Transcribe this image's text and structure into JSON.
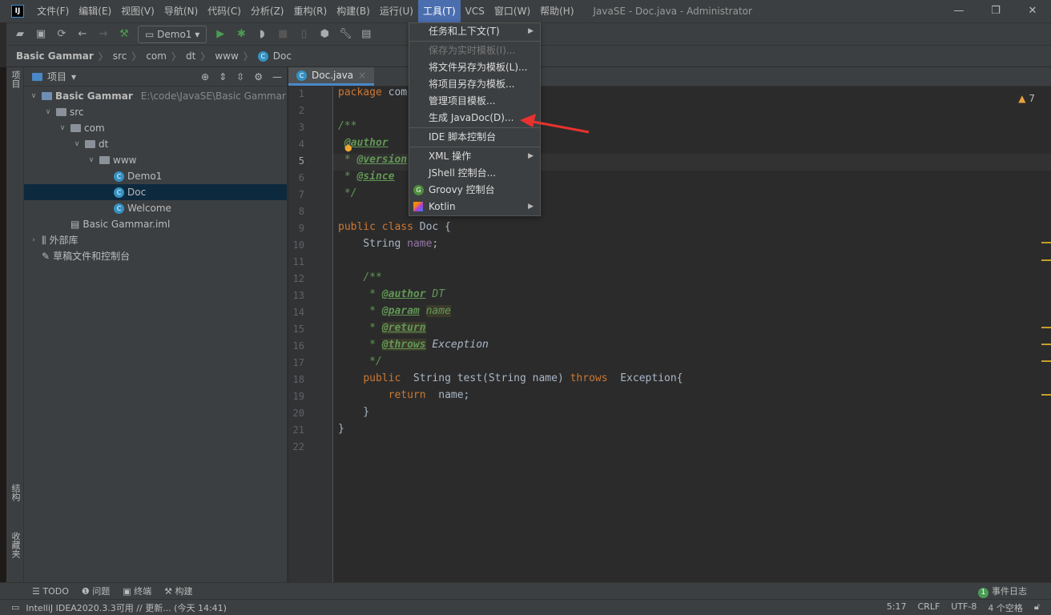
{
  "title": {
    "menus": [
      "文件(F)",
      "编辑(E)",
      "视图(V)",
      "导航(N)",
      "代码(C)",
      "分析(Z)",
      "重构(R)",
      "构建(B)",
      "运行(U)",
      "工具(T)",
      "VCS",
      "窗口(W)",
      "帮助(H)"
    ],
    "window_title": "JavaSE - Doc.java - Administrator",
    "logo": "IJ"
  },
  "toolbar": {
    "run_config": "Demo1"
  },
  "breadcrumb": [
    "Basic Gammar",
    "src",
    "com",
    "dt",
    "www",
    "Doc"
  ],
  "leftstrip": {
    "project": "项目",
    "structure": "结构",
    "favorites": "收藏夹"
  },
  "project": {
    "title": "项目",
    "tree": [
      {
        "label": "Basic Gammar",
        "path": "E:\\code\\JavaSE\\Basic Gammar",
        "depth": 0,
        "arrow": "v",
        "icon": "module-folder"
      },
      {
        "label": "src",
        "depth": 1,
        "arrow": "v",
        "icon": "folder"
      },
      {
        "label": "com",
        "depth": 2,
        "arrow": "v",
        "icon": "folder"
      },
      {
        "label": "dt",
        "depth": 3,
        "arrow": "v",
        "icon": "folder"
      },
      {
        "label": "www",
        "depth": 4,
        "arrow": "v",
        "icon": "folder"
      },
      {
        "label": "Demo1",
        "depth": 5,
        "icon": "class"
      },
      {
        "label": "Doc",
        "depth": 5,
        "icon": "class",
        "selected": true
      },
      {
        "label": "Welcome",
        "depth": 5,
        "icon": "class"
      },
      {
        "label": "Basic Gammar.iml",
        "depth": 2,
        "icon": "file"
      },
      {
        "label": "外部库",
        "depth": 0,
        "arrow": ">",
        "icon": "library"
      },
      {
        "label": "草稿文件和控制台",
        "depth": 0,
        "icon": "scratch"
      }
    ]
  },
  "editor": {
    "tab": "Doc.java",
    "warnings": "7",
    "current_line": 5
  },
  "popup": {
    "items": [
      {
        "label": "任务和上下文(T)",
        "submenu": true
      },
      {
        "sep": true
      },
      {
        "label": "保存为实时模板(I)...",
        "disabled": true
      },
      {
        "label": "将文件另存为模板(L)..."
      },
      {
        "label": "将项目另存为模板..."
      },
      {
        "label": "管理项目模板..."
      },
      {
        "label": "生成 JavaDoc(D)..."
      },
      {
        "sep": true
      },
      {
        "label": "IDE 脚本控制台"
      },
      {
        "sep": true
      },
      {
        "label": "XML 操作",
        "submenu": true
      },
      {
        "label": "JShell 控制台..."
      },
      {
        "label": "Groovy 控制台",
        "icon": "groovy"
      },
      {
        "label": "Kotlin",
        "submenu": true,
        "icon": "kotlin"
      }
    ]
  },
  "bottom": {
    "tools": [
      "TODO",
      "问题",
      "终端",
      "构建"
    ],
    "event_log": "事件日志",
    "event_count": "1"
  },
  "status": {
    "message": "IntelliJ IDEA2020.3.3可用 // 更新... (今天 14:41)",
    "position": "5:17",
    "line_sep": "CRLF",
    "encoding": "UTF-8",
    "indent": "4 个空格"
  },
  "colors": {
    "accent": "#4b6eaf",
    "arrow": "#e8322f"
  }
}
